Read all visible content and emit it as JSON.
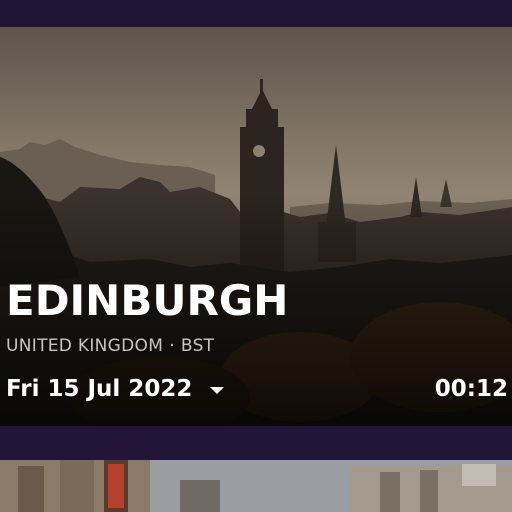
{
  "location": {
    "city": "EDINBURGH",
    "country": "UNITED KINGDOM",
    "separator": "·",
    "timezone": "BST"
  },
  "datetime": {
    "date": "Fri 15 Jul 2022",
    "time": "00:12"
  },
  "colors": {
    "background": "#221539",
    "text_primary": "#ffffff",
    "text_secondary": "#c8c6c4"
  },
  "icons": {
    "date_dropdown": "caret-down-icon"
  }
}
